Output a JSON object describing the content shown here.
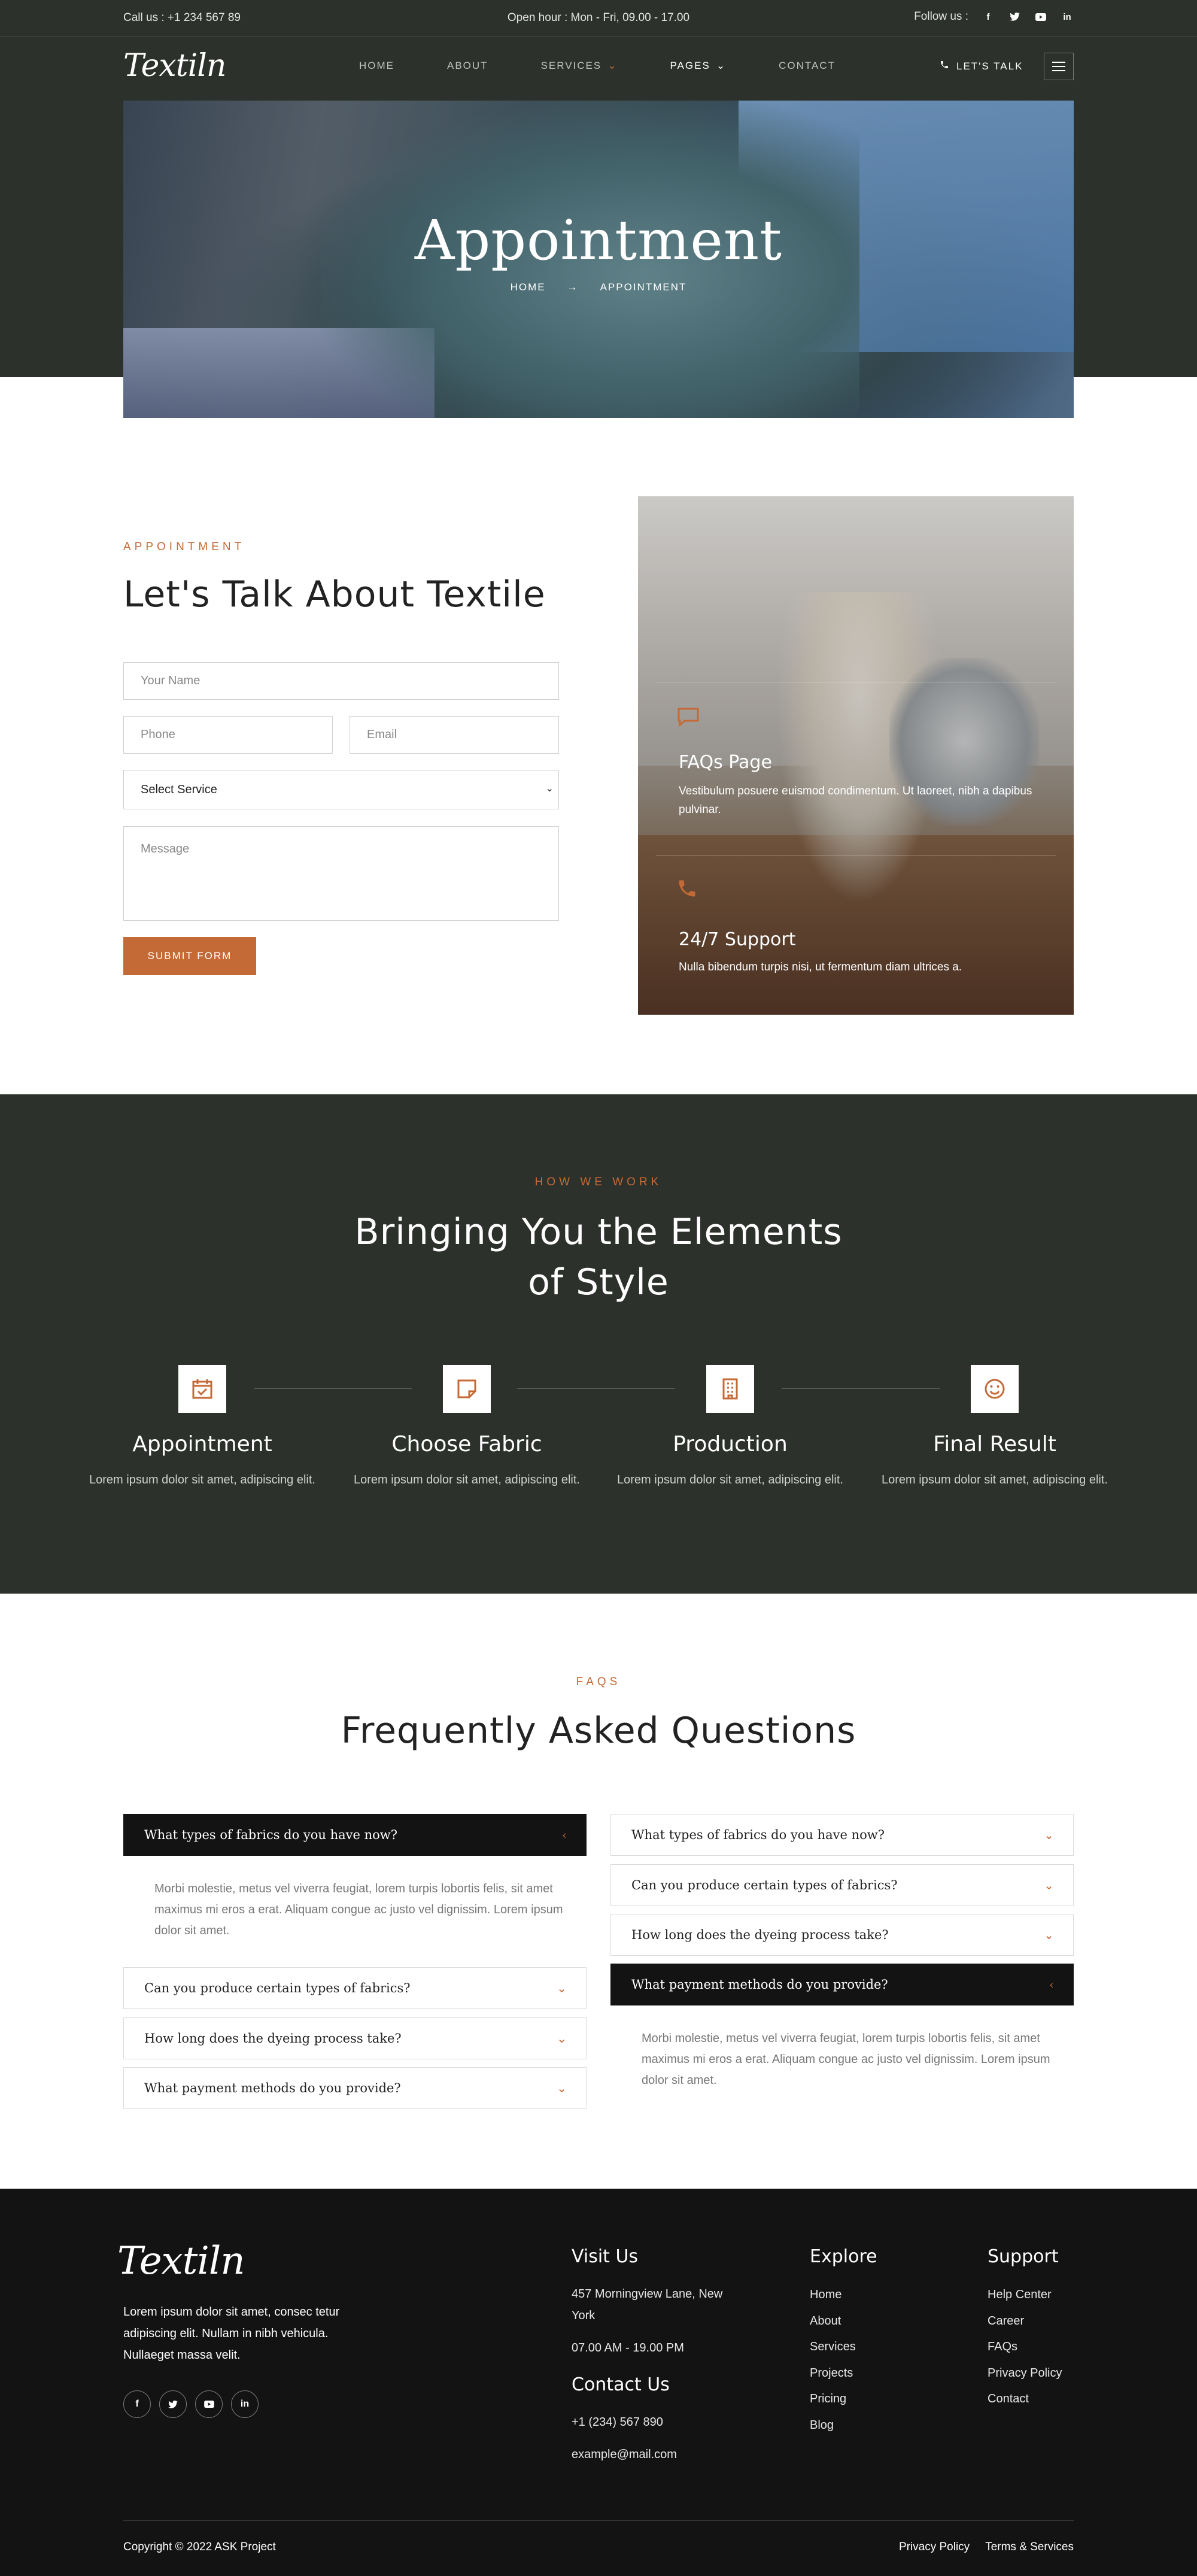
{
  "topbar": {
    "call": "Call us : +1 234 567 89",
    "hours": "Open hour : Mon - Fri, 09.00 - 17.00",
    "follow": "Follow us :",
    "social": [
      "f",
      "t",
      "yt",
      "in"
    ]
  },
  "header": {
    "logo": "Textiln",
    "nav": [
      "HOME",
      "ABOUT",
      "SERVICES",
      "PAGES",
      "CONTACT"
    ],
    "talk": "LET'S TALK"
  },
  "hero": {
    "title": "Appointment",
    "crumb_home": "HOME",
    "crumb_arrow": "→",
    "crumb_current": "APPOINTMENT"
  },
  "appointment": {
    "kicker": "APPOINTMENT",
    "title": "Let's Talk About Textile",
    "name_ph": "Your Name",
    "phone_ph": "Phone",
    "email_ph": "Email",
    "service_value": "Select Service",
    "message_ph": "Message",
    "submit": "SUBMIT FORM",
    "card1_title": "FAQs Page",
    "card1_text": "Vestibulum posuere euismod condimentum. Ut laoreet, nibh a dapibus pulvinar.",
    "card2_title": "24/7 Support",
    "card2_text": "Nulla bibendum turpis nisi, ut fermentum diam ultrices a."
  },
  "how": {
    "kicker": "HOW WE WORK",
    "title_l1": "Bringing You the Elements",
    "title_l2": "of Style",
    "steps": [
      {
        "title": "Appointment",
        "text": "Lorem ipsum dolor sit amet, adipiscing elit.",
        "icon": "calendar-check-icon"
      },
      {
        "title": "Choose Fabric",
        "text": "Lorem ipsum dolor sit amet, adipiscing elit.",
        "icon": "sticky-note-icon"
      },
      {
        "title": "Production",
        "text": "Lorem ipsum dolor sit amet, adipiscing elit.",
        "icon": "building-icon"
      },
      {
        "title": "Final Result",
        "text": "Lorem ipsum dolor sit amet, adipiscing elit.",
        "icon": "smile-icon"
      }
    ]
  },
  "faqs": {
    "kicker": "FAQS",
    "title": "Frequently Asked Questions",
    "left": [
      "What types of fabrics do you have now?",
      "Can you produce certain types of fabrics?",
      "How long does the dyeing process take?",
      "What payment methods do you provide?"
    ],
    "right": [
      "What types of fabrics do you have now?",
      "Can you produce certain types of fabrics?",
      "How long does the dyeing process take?",
      "What payment methods do you provide?"
    ],
    "answer": "Morbi molestie, metus vel viverra feugiat, lorem turpis lobortis felis, sit amet maximus mi eros a erat. Aliquam congue ac justo vel dignissim. Lorem ipsum dolor sit amet."
  },
  "footer": {
    "logo": "Textiln",
    "desc": "Lorem ipsum dolor sit amet, consec tetur adipiscing elit. Nullam in nibh vehicula. Nullaeget massa velit.",
    "visit_h": "Visit Us",
    "address": "457 Morningview Lane, New York",
    "hours": "07.00 AM - 19.00 PM",
    "contact_h": "Contact Us",
    "phone": "+1 (234) 567 890",
    "email": "example@mail.com",
    "explore_h": "Explore",
    "explore": [
      "Home",
      "About",
      "Services",
      "Projects",
      "Pricing",
      "Blog"
    ],
    "support_h": "Support",
    "support": [
      "Help Center",
      "Career",
      "FAQs",
      "Privacy Policy",
      "Contact"
    ],
    "copyright": "Copyright © 2022 ASK Project",
    "privacy": "Privacy Policy",
    "terms": "Terms & Services"
  },
  "colors": {
    "dark": "#2d312b",
    "accent": "#c46a36",
    "footer": "#131313"
  }
}
